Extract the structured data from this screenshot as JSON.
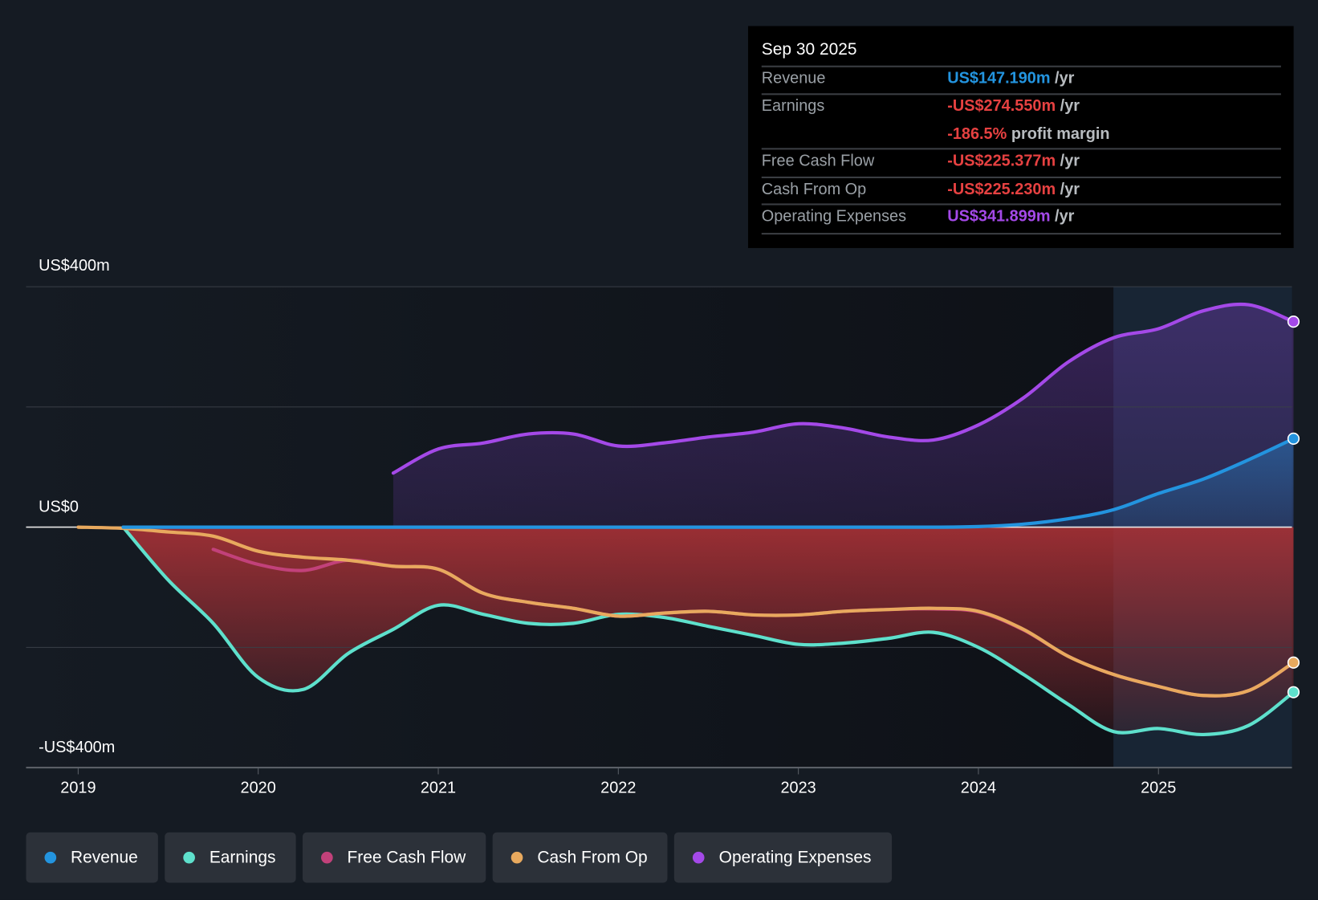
{
  "tooltip": {
    "date": "Sep 30 2025",
    "rows": [
      {
        "label": "Revenue",
        "value": "US$147.190m",
        "unit": "/yr",
        "color": "#2394df"
      },
      {
        "label": "Earnings",
        "value": "-US$274.550m",
        "unit": "/yr",
        "color": "#e64141",
        "extra_value": "-186.5%",
        "extra_text": "profit margin"
      },
      {
        "label": "Free Cash Flow",
        "value": "-US$225.377m",
        "unit": "/yr",
        "color": "#e64141"
      },
      {
        "label": "Cash From Op",
        "value": "-US$225.230m",
        "unit": "/yr",
        "color": "#e64141"
      },
      {
        "label": "Operating Expenses",
        "value": "US$341.899m",
        "unit": "/yr",
        "color": "#a449e8"
      }
    ]
  },
  "chart_data": {
    "type": "line",
    "title": "",
    "y_tick_labels": [
      "US$400m",
      "US$0",
      "-US$400m"
    ],
    "ylim": [
      -400,
      400
    ],
    "xlim": [
      2018.75,
      2025.75
    ],
    "x_tick_labels": [
      "2019",
      "2020",
      "2021",
      "2022",
      "2023",
      "2024",
      "2025"
    ],
    "forecast_shading_from": 2024.75,
    "series": [
      {
        "name": "Revenue",
        "color": "#2394df",
        "points": [
          [
            2019.25,
            0
          ],
          [
            2020,
            0
          ],
          [
            2021,
            0
          ],
          [
            2022,
            0
          ],
          [
            2023,
            0
          ],
          [
            2023.75,
            0
          ],
          [
            2024,
            1
          ],
          [
            2024.25,
            5
          ],
          [
            2024.5,
            14
          ],
          [
            2024.75,
            29
          ],
          [
            2025,
            56
          ],
          [
            2025.25,
            80
          ],
          [
            2025.5,
            112
          ],
          [
            2025.75,
            147.19
          ]
        ]
      },
      {
        "name": "Earnings",
        "color": "#5ee0cc",
        "points": [
          [
            2019.25,
            0
          ],
          [
            2019.5,
            -88
          ],
          [
            2019.75,
            -160
          ],
          [
            2020,
            -250
          ],
          [
            2020.25,
            -270
          ],
          [
            2020.5,
            -210
          ],
          [
            2020.75,
            -170
          ],
          [
            2021,
            -130
          ],
          [
            2021.25,
            -145
          ],
          [
            2021.5,
            -160
          ],
          [
            2021.75,
            -160
          ],
          [
            2022,
            -145
          ],
          [
            2022.25,
            -150
          ],
          [
            2022.5,
            -165
          ],
          [
            2022.75,
            -180
          ],
          [
            2023,
            -195
          ],
          [
            2023.25,
            -193
          ],
          [
            2023.5,
            -185
          ],
          [
            2023.75,
            -175
          ],
          [
            2024,
            -200
          ],
          [
            2024.25,
            -245
          ],
          [
            2024.5,
            -295
          ],
          [
            2024.75,
            -340
          ],
          [
            2025,
            -335
          ],
          [
            2025.25,
            -345
          ],
          [
            2025.5,
            -330
          ],
          [
            2025.75,
            -274.55
          ]
        ]
      },
      {
        "name": "Free Cash Flow",
        "color": "#c2417a",
        "points": [
          [
            2019.75,
            -37
          ],
          [
            2020,
            -62
          ],
          [
            2020.25,
            -72
          ],
          [
            2020.5,
            -55
          ],
          [
            2020.75,
            -65
          ],
          [
            2021,
            -70
          ],
          [
            2021.25,
            -110
          ],
          [
            2021.5,
            -125
          ],
          [
            2021.75,
            -135
          ],
          [
            2022,
            -148
          ],
          [
            2022.25,
            -143
          ],
          [
            2022.5,
            -140
          ],
          [
            2022.75,
            -146
          ],
          [
            2023,
            -146
          ],
          [
            2023.25,
            -140
          ],
          [
            2023.5,
            -137
          ],
          [
            2023.75,
            -136
          ],
          [
            2024,
            -141
          ],
          [
            2024.25,
            -171
          ],
          [
            2024.5,
            -215
          ],
          [
            2024.75,
            -245
          ],
          [
            2025,
            -265
          ],
          [
            2025.25,
            -280
          ],
          [
            2025.5,
            -272
          ],
          [
            2025.75,
            -225.38
          ]
        ]
      },
      {
        "name": "Cash From Op",
        "color": "#e8a95e",
        "points": [
          [
            2019,
            0
          ],
          [
            2019.25,
            -2
          ],
          [
            2019.5,
            -8
          ],
          [
            2019.75,
            -15
          ],
          [
            2020,
            -40
          ],
          [
            2020.25,
            -50
          ],
          [
            2020.5,
            -55
          ],
          [
            2020.75,
            -65
          ],
          [
            2021,
            -70
          ],
          [
            2021.25,
            -110
          ],
          [
            2021.5,
            -125
          ],
          [
            2021.75,
            -135
          ],
          [
            2022,
            -148
          ],
          [
            2022.25,
            -143
          ],
          [
            2022.5,
            -140
          ],
          [
            2022.75,
            -146
          ],
          [
            2023,
            -146
          ],
          [
            2023.25,
            -140
          ],
          [
            2023.5,
            -137
          ],
          [
            2023.75,
            -135
          ],
          [
            2024,
            -140
          ],
          [
            2024.25,
            -170
          ],
          [
            2024.5,
            -215
          ],
          [
            2024.75,
            -245
          ],
          [
            2025,
            -265
          ],
          [
            2025.25,
            -280
          ],
          [
            2025.5,
            -272
          ],
          [
            2025.75,
            -225.23
          ]
        ]
      },
      {
        "name": "Operating Expenses",
        "color": "#a449e8",
        "points": [
          [
            2020.75,
            90
          ],
          [
            2021,
            130
          ],
          [
            2021.25,
            140
          ],
          [
            2021.5,
            155
          ],
          [
            2021.75,
            155
          ],
          [
            2022,
            135
          ],
          [
            2022.25,
            140
          ],
          [
            2022.5,
            150
          ],
          [
            2022.75,
            158
          ],
          [
            2023,
            172
          ],
          [
            2023.25,
            165
          ],
          [
            2023.5,
            150
          ],
          [
            2023.75,
            145
          ],
          [
            2024,
            170
          ],
          [
            2024.25,
            215
          ],
          [
            2024.5,
            275
          ],
          [
            2024.75,
            315
          ],
          [
            2025,
            330
          ],
          [
            2025.25,
            360
          ],
          [
            2025.5,
            370
          ],
          [
            2025.75,
            341.9
          ]
        ]
      }
    ]
  },
  "legend": [
    "Revenue",
    "Earnings",
    "Free Cash Flow",
    "Cash From Op",
    "Operating Expenses"
  ]
}
